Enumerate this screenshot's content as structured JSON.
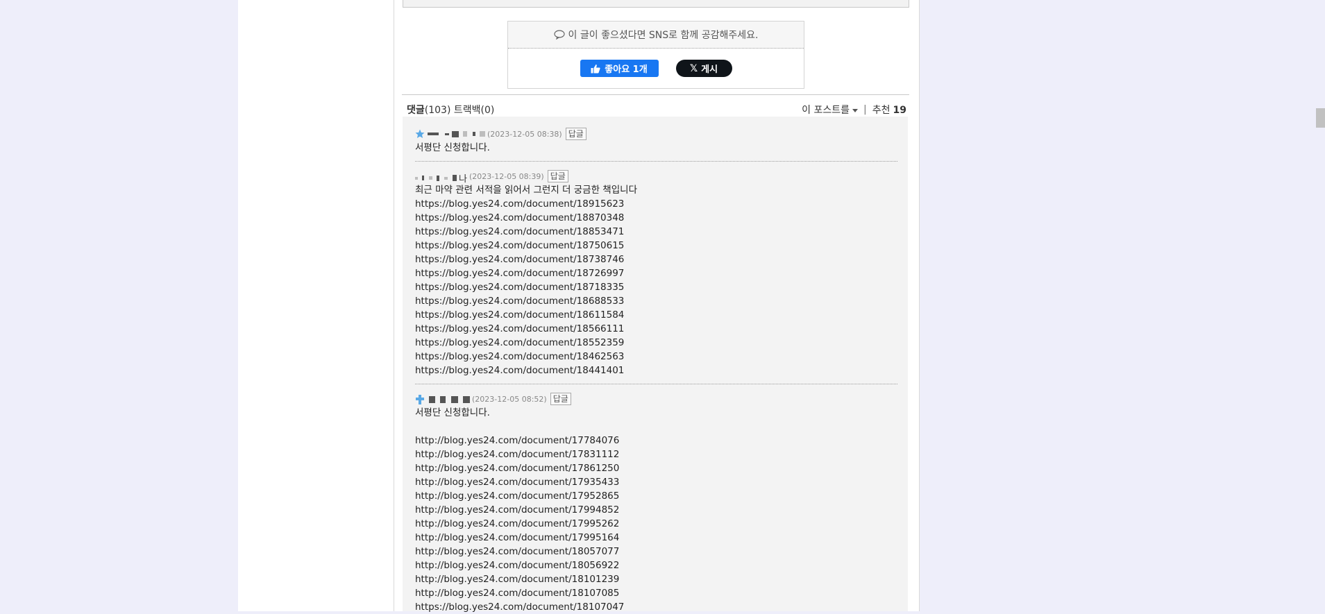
{
  "sns": {
    "message": "이 글이 좋으셨다면 SNS로 함께 공감해주세요.",
    "fb_like_label": "좋아요 1개",
    "x_post_label": "게시"
  },
  "comment_header": {
    "comments_label": "댓글",
    "comments_count": "(103)",
    "trackback_label": "트랙백(0)",
    "post_menu_label": "이 포스트를",
    "recommend_label": "추천",
    "recommend_count": "19"
  },
  "comments": [
    {
      "date": "(2023-12-05 08:38)",
      "reply_label": "답글",
      "lines": [
        "서평단 신청합니다."
      ]
    },
    {
      "nick_suffix": "나",
      "date": "(2023-12-05 08:39)",
      "reply_label": "답글",
      "lines": [
        "최근 마약 관련 서적을 읽어서 그런지 더 궁금한 책입니다",
        "https://blog.yes24.com/document/18915623",
        "https://blog.yes24.com/document/18870348",
        "https://blog.yes24.com/document/18853471",
        "https://blog.yes24.com/document/18750615",
        "https://blog.yes24.com/document/18738746",
        "https://blog.yes24.com/document/18726997",
        "https://blog.yes24.com/document/18718335",
        "https://blog.yes24.com/document/18688533",
        "https://blog.yes24.com/document/18611584",
        "https://blog.yes24.com/document/18566111",
        "https://blog.yes24.com/document/18552359",
        "https://blog.yes24.com/document/18462563",
        "https://blog.yes24.com/document/18441401"
      ]
    },
    {
      "date": "(2023-12-05 08:52)",
      "reply_label": "답글",
      "lines": [
        "서평단 신청합니다.",
        "",
        "http://blog.yes24.com/document/17784076",
        "http://blog.yes24.com/document/17831112",
        "http://blog.yes24.com/document/17861250",
        "http://blog.yes24.com/document/17935433",
        "http://blog.yes24.com/document/17952865",
        "http://blog.yes24.com/document/17994852",
        "http://blog.yes24.com/document/17995262",
        "http://blog.yes24.com/document/17995164",
        "http://blog.yes24.com/document/18057077",
        "http://blog.yes24.com/document/18056922",
        "http://blog.yes24.com/document/18101239",
        "http://blog.yes24.com/document/18107085",
        "https://blog.yes24.com/document/18107047"
      ]
    }
  ],
  "colors": {
    "page_bg": "#eeeefa",
    "fb_blue": "#1877f2",
    "x_black": "#0f1419",
    "comment_bg": "#f3f3f3"
  }
}
